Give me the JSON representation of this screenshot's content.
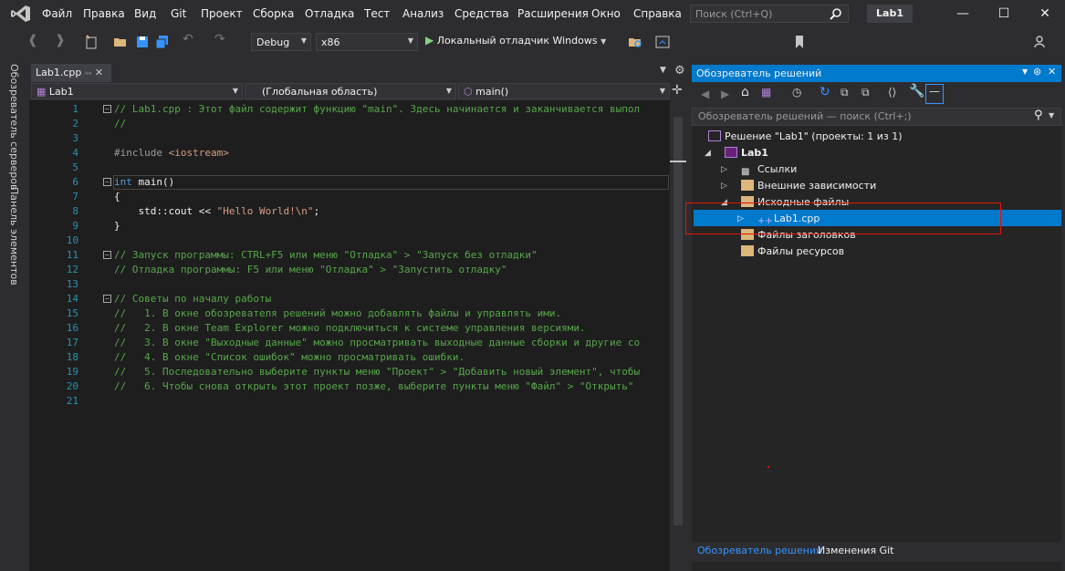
{
  "menu": [
    "Файл",
    "Правка",
    "Вид",
    "Git",
    "Проект",
    "Сборка",
    "Отладка",
    "Тест",
    "Анализ",
    "Средства",
    "Расширения",
    "Окно",
    "Справка"
  ],
  "search": {
    "placeholder": "Поиск (Ctrl+Q)"
  },
  "title": "Lab1",
  "toolbar": {
    "config": "Debug",
    "platform": "x86",
    "run_label": "Локальный отладчик Windows"
  },
  "left_tabs": [
    "Обозреватель серверов",
    "Панель элементов"
  ],
  "doc_tab": "Lab1.cpp",
  "nav": {
    "project": "Lab1",
    "scope": "(Глобальная область)",
    "member": "main()"
  },
  "code_lines": [
    {
      "n": "1",
      "t": "// Lab1.cpp : Этот файл содержит функцию \"main\". Здесь начинается и заканчивается выпол"
    },
    {
      "n": "2",
      "t": "//"
    },
    {
      "n": "3",
      "t": ""
    },
    {
      "n": "4",
      "t": "#include <iostream>"
    },
    {
      "n": "5",
      "t": ""
    },
    {
      "n": "6",
      "t": "int main()"
    },
    {
      "n": "7",
      "t": "{"
    },
    {
      "n": "8",
      "t": "    std::cout << \"Hello World!\\n\";"
    },
    {
      "n": "9",
      "t": "}"
    },
    {
      "n": "10",
      "t": ""
    },
    {
      "n": "11",
      "t": "// Запуск программы: CTRL+F5 или меню \"Отладка\" > \"Запуск без отладки\""
    },
    {
      "n": "12",
      "t": "// Отладка программы: F5 или меню \"Отладка\" > \"Запустить отладку\""
    },
    {
      "n": "13",
      "t": ""
    },
    {
      "n": "14",
      "t": "// Советы по началу работы"
    },
    {
      "n": "15",
      "t": "//   1. В окне обозревателя решений можно добавлять файлы и управлять ими."
    },
    {
      "n": "16",
      "t": "//   2. В окне Team Explorer можно подключиться к системе управления версиями."
    },
    {
      "n": "17",
      "t": "//   3. В окне \"Выходные данные\" можно просматривать выходные данные сборки и другие со"
    },
    {
      "n": "18",
      "t": "//   4. В окне \"Список ошибок\" можно просматривать ошибки."
    },
    {
      "n": "19",
      "t": "//   5. Последовательно выберите пункты меню \"Проект\" > \"Добавить новый элемент\", чтобы"
    },
    {
      "n": "20",
      "t": "//   6. Чтобы снова открыть этот проект позже, выберите пункты меню \"Файл\" > \"Открыть\""
    },
    {
      "n": "21",
      "t": ""
    }
  ],
  "solution_explorer": {
    "title": "Обозреватель решений",
    "search_placeholder": "Обозреватель решений — поиск (Ctrl+;)",
    "items": [
      "Решение \"Lab1\" (проекты: 1 из 1)",
      "Lab1",
      "Ссылки",
      "Внешние зависимости",
      "Исходные файлы",
      "Lab1.cpp",
      "Файлы заголовков",
      "Файлы ресурсов"
    ],
    "bottom_tabs": [
      "Обозреватель решений",
      "Изменения Git"
    ]
  },
  "colors": {
    "accent": "#007acc",
    "highlight_box": "#e51400",
    "comment": "#57a64a",
    "keyword": "#569cd6",
    "string": "#d69d85"
  }
}
